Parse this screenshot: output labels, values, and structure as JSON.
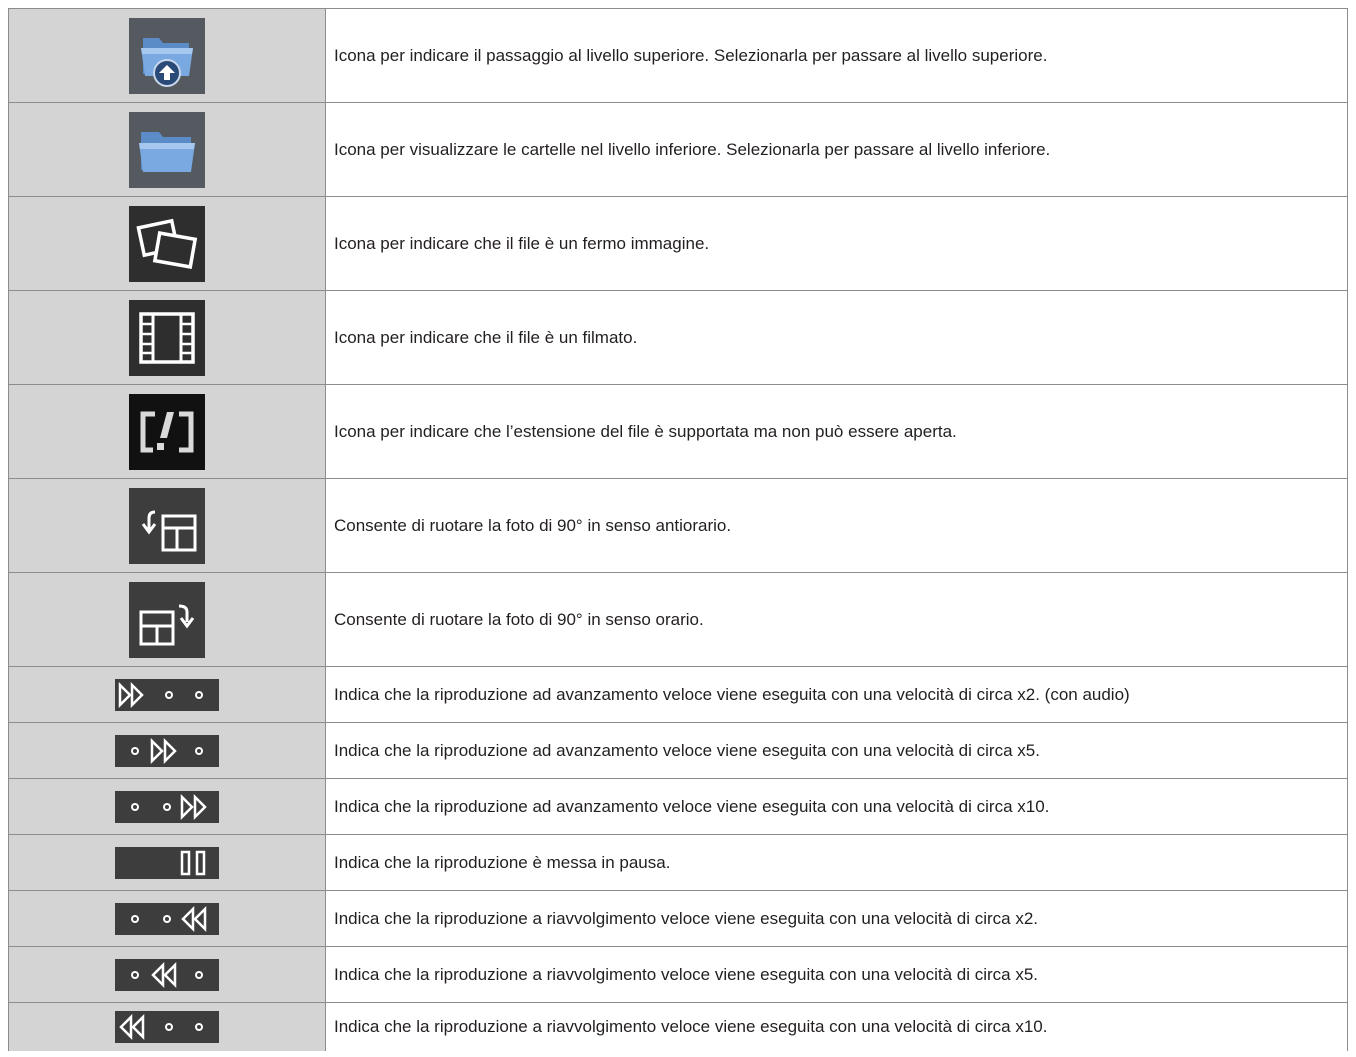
{
  "rows": [
    {
      "icon": "folder-up-icon",
      "text": "Icona per indicare il passaggio al livello superiore. Selezionarla per passare al livello superiore."
    },
    {
      "icon": "folder-icon",
      "text": "Icona per visualizzare le cartelle nel livello inferiore. Selezionarla per passare al livello inferiore."
    },
    {
      "icon": "still-image-icon",
      "text": "Icona per indicare che il file è un fermo immagine."
    },
    {
      "icon": "movie-file-icon",
      "text": "Icona per indicare che il file è un filmato."
    },
    {
      "icon": "unsupported-file-icon",
      "text": "Icona per indicare che l’estensione del file è supportata ma non può essere aperta."
    },
    {
      "icon": "rotate-left-icon",
      "text": "Consente di ruotare la foto di 90° in senso antiorario."
    },
    {
      "icon": "rotate-right-icon",
      "text": "Consente di ruotare la foto di 90° in senso orario."
    },
    {
      "icon": "fast-forward-x2-icon",
      "text": "Indica che la riproduzione ad avanzamento veloce viene eseguita con una velocità di circa x2. (con audio)"
    },
    {
      "icon": "fast-forward-x5-icon",
      "text": "Indica che la riproduzione ad avanzamento veloce viene eseguita con una velocità di circa x5."
    },
    {
      "icon": "fast-forward-x10-icon",
      "text": "Indica che la riproduzione ad avanzamento veloce viene eseguita con una velocità di circa x10."
    },
    {
      "icon": "pause-icon",
      "text": "Indica che la riproduzione è messa in pausa."
    },
    {
      "icon": "rewind-x2-icon",
      "text": "Indica che la riproduzione a riavvolgimento veloce viene eseguita con una velocità di circa x2."
    },
    {
      "icon": "rewind-x5-icon",
      "text": "Indica che la riproduzione a riavvolgimento veloce viene eseguita con una velocità di circa x5."
    },
    {
      "icon": "rewind-x10-icon",
      "text": "Indica che la riproduzione a riavvolgimento veloce viene eseguita con una velocità di circa x10."
    }
  ]
}
